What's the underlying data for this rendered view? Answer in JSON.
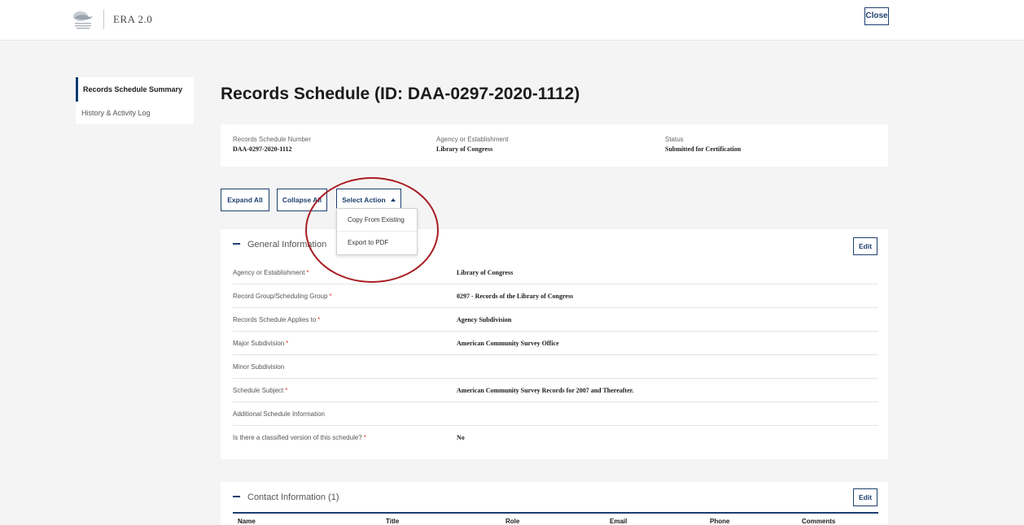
{
  "header": {
    "app_title": "ERA 2.0",
    "close_label": "Close"
  },
  "sidenav": {
    "items": [
      {
        "label": "Records Schedule Summary",
        "active": true
      },
      {
        "label": "History & Activity Log",
        "active": false
      }
    ]
  },
  "page": {
    "title": "Records Schedule (ID: DAA-0297-2020-1112)"
  },
  "summary": {
    "schedule_number_label": "Records Schedule Number",
    "schedule_number_value": "DAA-0297-2020-1112",
    "agency_label": "Agency or Establishment",
    "agency_value": "Library of Congress",
    "status_label": "Status",
    "status_value": "Submitted for Certification"
  },
  "actions": {
    "expand_all": "Expand All",
    "collapse_all": "Collapse All",
    "select_action": "Select Action",
    "dropdown_items": [
      "Copy From Existing",
      "Export to PDF"
    ]
  },
  "general": {
    "title": "General Information",
    "edit_label": "Edit",
    "rows": [
      {
        "label": "Agency or Establishment",
        "required": "*",
        "value": "Library of Congress"
      },
      {
        "label": "Record Group/Scheduling Group",
        "required": "*",
        "value": "0297 - Records of the Library of Congress"
      },
      {
        "label": "Records Schedule Applies to",
        "required": "*",
        "value": "Agency Subdivision"
      },
      {
        "label": "Major Subdivision",
        "required": "*",
        "value": "American Community Survey Office"
      },
      {
        "label": "Minor Subdivision",
        "required": "",
        "value": ""
      },
      {
        "label": "Schedule Subject",
        "required": "*",
        "value": "American Community Survey Records for 2007 and Thereafter."
      },
      {
        "label": "Additional Schedule Information",
        "required": "",
        "value": ""
      },
      {
        "label": "Is there a classified version of this schedule?",
        "required": "*",
        "value": "No"
      }
    ]
  },
  "contact": {
    "title": "Contact Information (1)",
    "edit_label": "Edit",
    "columns": [
      "Name",
      "Title",
      "Role",
      "Email",
      "Phone",
      "Comments"
    ]
  },
  "colors": {
    "primary": "#1d3f6e",
    "required": "#d83933",
    "annotation": "#a81c22"
  }
}
